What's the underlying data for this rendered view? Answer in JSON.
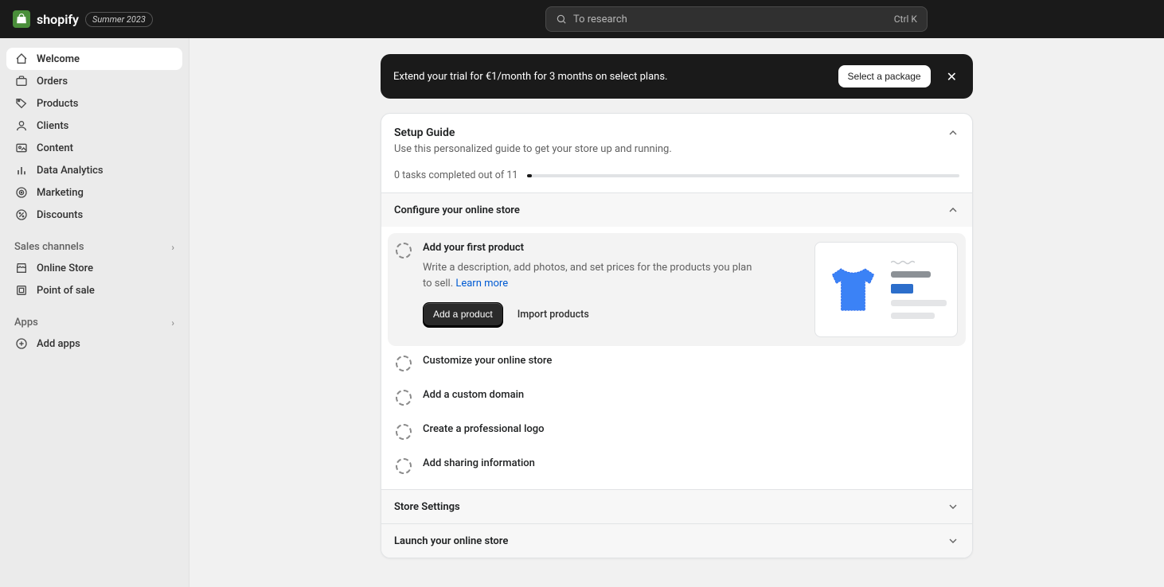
{
  "header": {
    "brand": "shopify",
    "edition": "Summer 2023",
    "search_placeholder": "To research",
    "shortcut": "Ctrl K"
  },
  "sidebar": {
    "items": [
      {
        "label": "Welcome",
        "icon": "home"
      },
      {
        "label": "Orders",
        "icon": "orders"
      },
      {
        "label": "Products",
        "icon": "tag"
      },
      {
        "label": "Clients",
        "icon": "user"
      },
      {
        "label": "Content",
        "icon": "content"
      },
      {
        "label": "Data Analytics",
        "icon": "analytics"
      },
      {
        "label": "Marketing",
        "icon": "marketing"
      },
      {
        "label": "Discounts",
        "icon": "discounts"
      }
    ],
    "channels_label": "Sales channels",
    "channels": [
      {
        "label": "Online Store"
      },
      {
        "label": "Point of sale"
      }
    ],
    "apps_label": "Apps",
    "add_apps": "Add apps"
  },
  "banner": {
    "text": "Extend your trial for €1/month for 3 months on select plans.",
    "cta": "Select a package"
  },
  "setup": {
    "title": "Setup Guide",
    "subtitle": "Use this personalized guide to get your store up and running.",
    "progress": "0 tasks completed out of 11",
    "sections": [
      {
        "title": "Configure your online store",
        "expanded": true,
        "tasks": [
          {
            "title": "Add your first product",
            "active": true,
            "desc": "Write a description, add photos, and set prices for the products you plan to sell. ",
            "learn_more": "Learn more",
            "primary_btn": "Add a product",
            "secondary_btn": "Import products"
          },
          {
            "title": "Customize your online store"
          },
          {
            "title": "Add a custom domain"
          },
          {
            "title": "Create a professional logo"
          },
          {
            "title": "Add sharing information"
          }
        ]
      },
      {
        "title": "Store Settings",
        "expanded": false
      },
      {
        "title": "Launch your online store",
        "expanded": false
      }
    ]
  }
}
